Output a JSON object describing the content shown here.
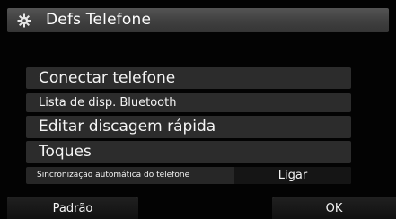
{
  "header": {
    "title": "Defs Telefone",
    "icon": "gear-icon"
  },
  "menu": {
    "items": [
      {
        "label": "Conectar telefone"
      },
      {
        "label": "Lista de disp. Bluetooth"
      },
      {
        "label": "Editar discagem rápida"
      },
      {
        "label": "Toques"
      }
    ],
    "sync": {
      "label": "Sincronização automática do telefone",
      "value": "Ligar"
    }
  },
  "footer": {
    "default_label": "Padrão",
    "ok_label": "OK"
  },
  "colors": {
    "background": "#030303",
    "title_bar": "#4a4a4a",
    "row": "#2c2c2c",
    "text": "#f4f4f4"
  }
}
